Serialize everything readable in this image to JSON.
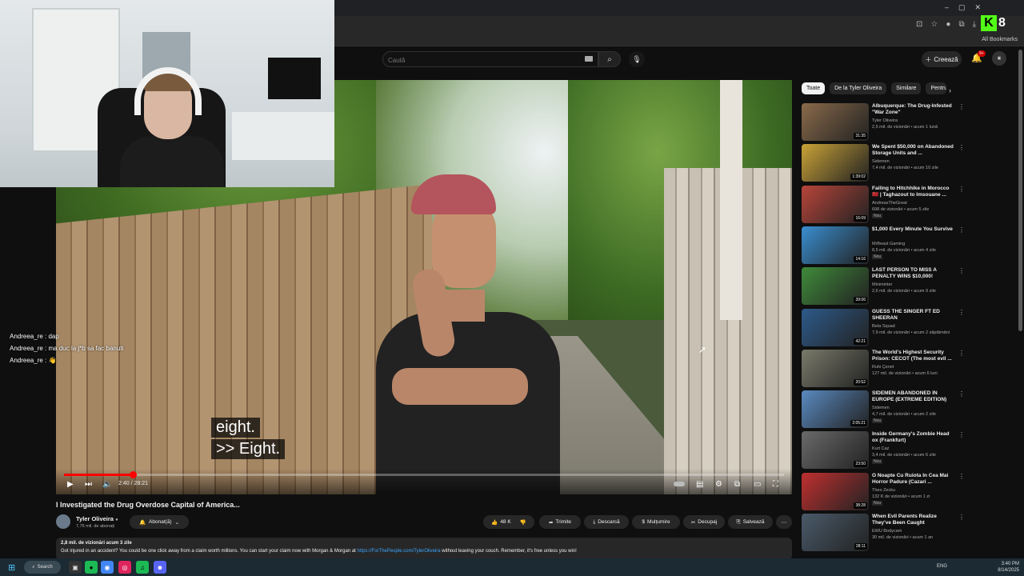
{
  "browser": {
    "all_bookmarks": "All Bookmarks",
    "kick_number": "8"
  },
  "header": {
    "search_placeholder": "Caută",
    "create_label": "Creează",
    "notif_badge": "9+"
  },
  "chat": [
    {
      "user": "Andreea_re",
      "text": "dap"
    },
    {
      "user": "Andreea_re",
      "text": "ma duc la j*b sa fac banuti"
    },
    {
      "user": "Andreea_re",
      "text": "👋"
    }
  ],
  "video": {
    "captions": [
      "eight.",
      ">> Eight."
    ],
    "time": "2:40 / 28:21",
    "progress": 0.095,
    "title": "I Investigated the Drug Overdose Capital of America..."
  },
  "channel": {
    "name": "Tyler Oliveira",
    "subs": "7,76 mil. de abonați",
    "subscribe_label": "Abonat(ă)"
  },
  "actions": {
    "likes": "48 K",
    "share": "Trimite",
    "download": "Descarcă",
    "thanks": "Mulțumire",
    "clip": "Decupaj",
    "save": "Salvează"
  },
  "description": {
    "meta": "2,8 mil. de vizionări  acum 3 zile",
    "text_before": "Got injured in an accident? You could be one click away from a claim worth millions. You can start your claim now with Morgan & Morgan at ",
    "link": "https://ForThePeople.com/TylerOliveira",
    "text_after": " without leaving your couch. Remember, it's free unless you win!"
  },
  "chips": [
    "Toate",
    "De la Tyler Oliveira",
    "Similare",
    "Pentru"
  ],
  "recommendations": [
    {
      "title": "Albuquerque: The Drug-Infested \"War Zone\"",
      "channel": "Tyler Oliveira",
      "meta": "2,5 mil. de vizionări • acum 1 lună",
      "duration": "31:35",
      "badge": "",
      "color": "#8a6a4a"
    },
    {
      "title": "We Spent $50,000 on Abandoned Storage Units and ...",
      "channel": "Sidemen",
      "meta": "7,4 mil. de vizionări • acum 10 zile",
      "duration": "1:39:02",
      "badge": "",
      "color": "#c9a237"
    },
    {
      "title": "Failing to Hitchhike in Morocco 🇲🇦 | Taghazout to Imsouane ...",
      "channel": "AndreasTheGreat",
      "meta": "698 de vizionări • acum 5 zile",
      "duration": "16:09",
      "badge": "Nou",
      "color": "#b8453a"
    },
    {
      "title": "$1,000 Every Minute You Survive",
      "channel": "MrBeast Gaming",
      "meta": "8,5 mil. de vizionări • acum 4 zile",
      "duration": "14:16",
      "badge": "Nou",
      "color": "#3a8ed0"
    },
    {
      "title": "LAST PERSON TO MISS A PENALTY WINS $10,000!",
      "channel": "Miniminter",
      "meta": "2,6 mil. de vizionări • acum 9 zile",
      "duration": "39:06",
      "badge": "",
      "color": "#3f8a3a"
    },
    {
      "title": "GUESS THE SINGER FT ED SHEERAN",
      "channel": "Beta Squad",
      "meta": "7,9 mil. de vizionări • acum 2 săptămâni",
      "duration": "42:21",
      "badge": "",
      "color": "#2d5a8a"
    },
    {
      "title": "The World's Highest Security Prison: CECOT (The most evil ...",
      "channel": "Ruhi Çenet",
      "meta": "127 mil. de vizionări • acum 6 luni",
      "duration": "20:52",
      "badge": "",
      "color": "#7a7a6a"
    },
    {
      "title": "SIDEMEN ABANDONED IN EUROPE (EXTREME EDITION)",
      "channel": "Sidemen",
      "meta": "4,7 mil. de vizionări • acum 2 zile",
      "duration": "2:05:21",
      "badge": "Nou",
      "color": "#5a8ac0"
    },
    {
      "title": "Inside Germany's Zombie Head ox (Frankfurt)",
      "channel": "Kurt Caz",
      "meta": "3,4 mil. de vizionări • acum 6 zile",
      "duration": "23:50",
      "badge": "Nou",
      "color": "#6a6a6a"
    },
    {
      "title": "O Noapte Cu Ruiota In Cea Mai Horror Padure (Cazari ...",
      "channel": "Theo Zecku",
      "meta": "132 K de vizionări • acum 1 zi",
      "duration": "38:28",
      "badge": "Nou",
      "color": "#c03030"
    },
    {
      "title": "When Evil Parents Realize They've Been Caught",
      "channel": "EWU Bodycam",
      "meta": "30 mil. de vizionări • acum 1 an",
      "duration": "28:11",
      "badge": "",
      "color": "#4a5a6a"
    }
  ],
  "taskbar": {
    "search_label": "Search",
    "lang": "ENG",
    "time": "3:40 PM",
    "date": "8/14/2025"
  }
}
